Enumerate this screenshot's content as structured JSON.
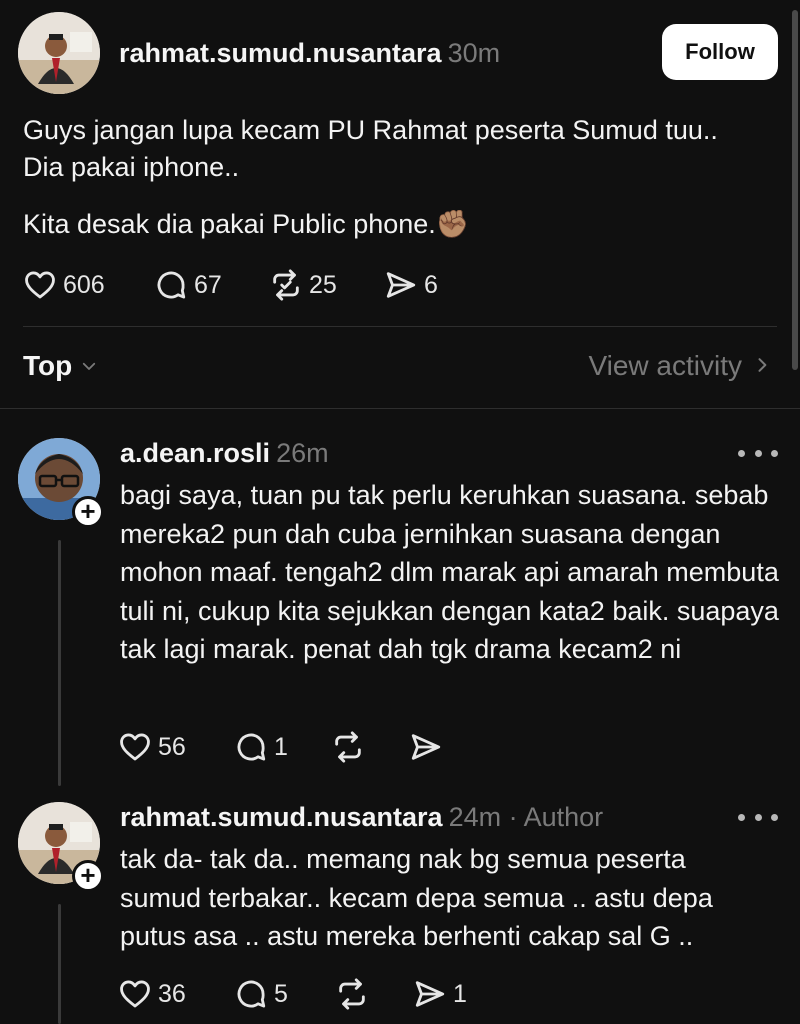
{
  "post": {
    "username": "rahmat.sumud.nusantara",
    "time": "30m",
    "follow_label": "Follow",
    "text_line_1": "Guys jangan lupa kecam PU Rahmat peserta Sumud tuu..",
    "text_line_2": "Dia pakai iphone..",
    "text_line_3": "Kita desak dia pakai Public phone.",
    "text_emoji": "✊🏽",
    "likes": "606",
    "replies": "67",
    "reposts": "25",
    "shares": "6"
  },
  "sort": {
    "label": "Top",
    "view_activity": "View activity"
  },
  "replies": [
    {
      "username": "a.dean.rosli",
      "time": "26m",
      "author_tag": "",
      "text": "bagi saya, tuan pu tak perlu keruhkan suasana. sebab mereka2 pun dah cuba jernihkan suasana dengan mohon maaf. tengah2 dlm marak api amarah membuta tuli ni, cukup kita sejukkan dengan kata2 baik. suapaya tak lagi marak. penat dah tgk drama kecam2 ni",
      "likes": "56",
      "replies": "1",
      "reposts": "",
      "shares": ""
    },
    {
      "username": "rahmat.sumud.nusantara",
      "time": "24m",
      "author_tag": "· Author",
      "text": "tak da- tak da.. memang nak bg semua peserta sumud terbakar.. kecam depa semua .. astu depa putus asa .. astu mereka berhenti cakap sal G ..",
      "likes": "36",
      "replies": "5",
      "reposts": "",
      "shares": "1"
    }
  ],
  "icons": {
    "like": "heart-icon",
    "reply": "comment-icon",
    "repost": "repost-icon",
    "share": "send-icon",
    "more": "more-icon",
    "chevron_down": "chevron-down-icon",
    "chevron_right": "chevron-right-icon"
  },
  "colors": {
    "background": "#101010",
    "text": "#f3f3f3",
    "muted": "#7a7a7a",
    "follow_bg": "#ffffff"
  }
}
